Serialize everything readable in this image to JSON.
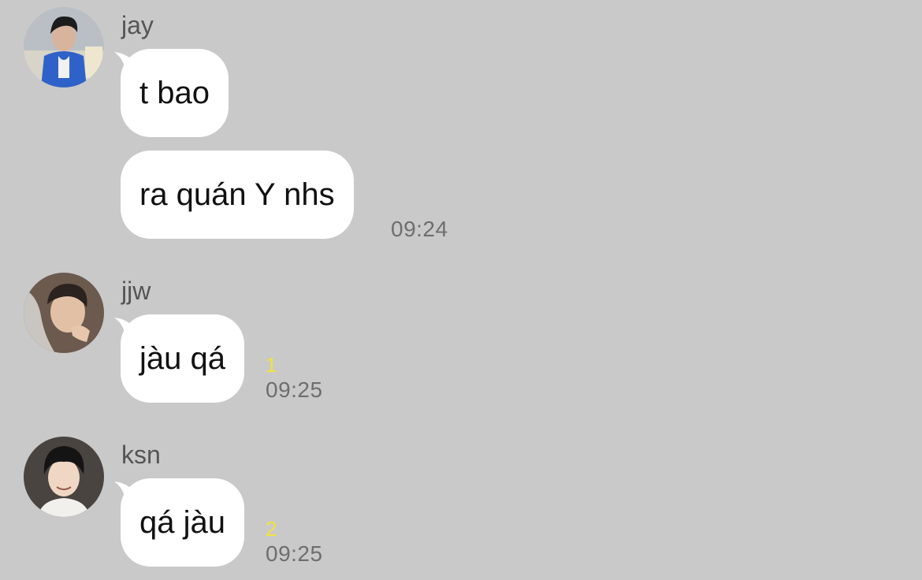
{
  "colors": {
    "background": "#c9c9c9",
    "bubble": "#ffffff",
    "unread": "#f2e33a",
    "time": "#6e6e6e"
  },
  "messages": [
    {
      "sender": "jay",
      "avatar": "avatar-jay",
      "bubbles": [
        "t bao",
        "ra quán Y nhs"
      ],
      "unread": "",
      "time": "09:24"
    },
    {
      "sender": "jjw",
      "avatar": "avatar-jjw",
      "bubbles": [
        "jàu qá"
      ],
      "unread": "1",
      "time": "09:25"
    },
    {
      "sender": "ksn",
      "avatar": "avatar-ksn",
      "bubbles": [
        "qá jàu"
      ],
      "unread": "2",
      "time": "09:25"
    }
  ]
}
